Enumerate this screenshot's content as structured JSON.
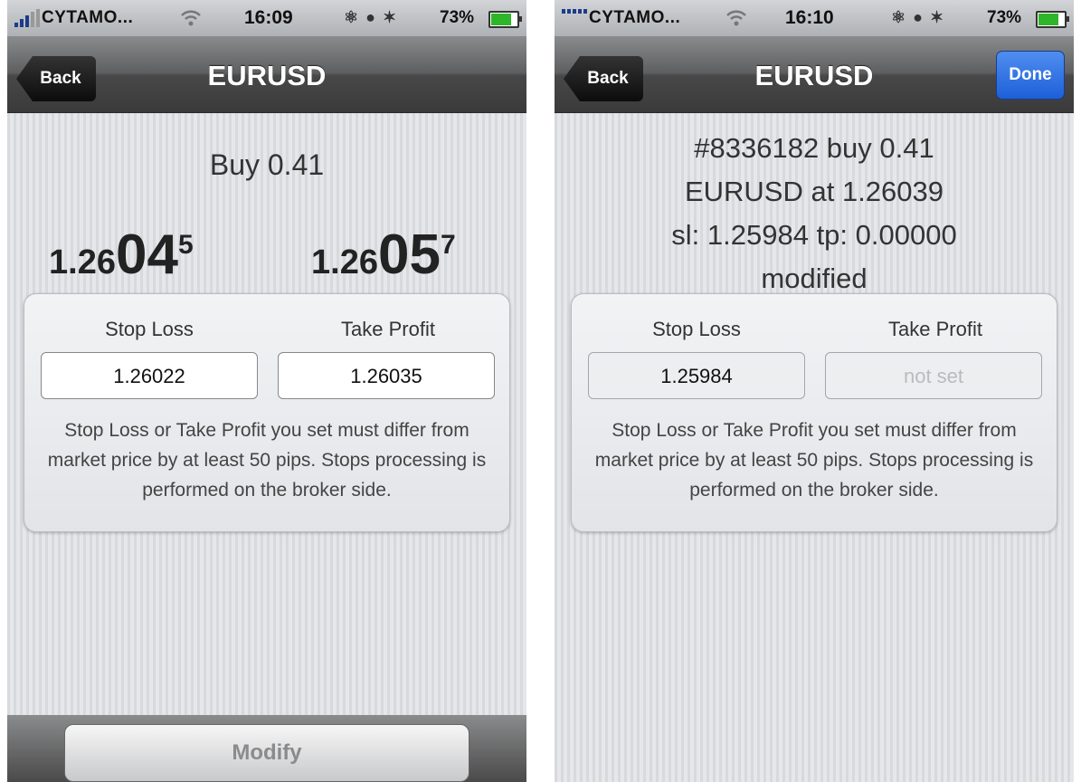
{
  "left": {
    "status": {
      "carrier": "CYTAMO...",
      "time": "16:09",
      "battery": "73%",
      "battery_level": 0.73
    },
    "nav": {
      "back_label": "Back",
      "title": "EURUSD"
    },
    "buy_title": "Buy 0.41",
    "bid": {
      "base": "1.26",
      "big": "04",
      "sup": "5"
    },
    "ask": {
      "base": "1.26",
      "big": "05",
      "sup": "7"
    },
    "panel": {
      "sl_label": "Stop Loss",
      "tp_label": "Take Profit",
      "sl_value": "1.26022",
      "tp_value": "1.26035",
      "note": "Stop Loss or Take Profit you set must differ from market price by at least 50 pips. Stops processing is performed on the broker side."
    },
    "modify_label": "Modify"
  },
  "right": {
    "status": {
      "carrier": "CYTAMO...",
      "time": "16:10",
      "battery": "73%",
      "battery_level": 0.73
    },
    "nav": {
      "back_label": "Back",
      "title": "EURUSD",
      "done_label": "Done"
    },
    "info": {
      "line1": "#8336182 buy 0.41",
      "line2": "EURUSD at 1.26039",
      "line3": "sl: 1.25984 tp: 0.00000",
      "line4": "modified"
    },
    "panel": {
      "sl_label": "Stop Loss",
      "tp_label": "Take Profit",
      "sl_value": "1.25984",
      "tp_placeholder": "not set",
      "note": "Stop Loss or Take Profit you set must differ from market price by at least 50 pips. Stops processing is performed on the broker side."
    }
  },
  "colors": {
    "navbar": "#4a4a4b",
    "done_button": "#2a6ee0",
    "battery_fill": "#2fb52a"
  }
}
